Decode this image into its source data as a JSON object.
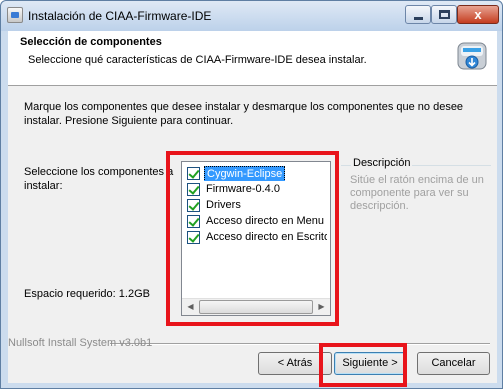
{
  "window": {
    "title": "Instalación de CIAA-Firmware-IDE",
    "close_glyph": "x"
  },
  "header": {
    "title": "Selección de componentes",
    "subtitle": "Seleccione qué características de CIAA-Firmware-IDE desea instalar."
  },
  "intro_text": "Marque los componentes que desee instalar y desmarque los componentes que no desee instalar. Presione Siguiente para continuar.",
  "select_label": "Seleccione los componentes a instalar:",
  "components": [
    {
      "label": "Cygwin-Eclipse",
      "checked": true,
      "selected": true
    },
    {
      "label": "Firmware-0.4.0",
      "checked": true,
      "selected": false
    },
    {
      "label": "Drivers",
      "checked": true,
      "selected": false
    },
    {
      "label": "Acceso directo en Menu Inicio",
      "checked": true,
      "selected": false
    },
    {
      "label": "Acceso directo en Escritorio",
      "checked": true,
      "selected": false
    }
  ],
  "space_required": "Espacio requerido: 1.2GB",
  "description": {
    "title": "Descripción",
    "text": "Sitúe el ratón encima de un componente para ver su descripción."
  },
  "footer": {
    "branding": "Nullsoft Install System v3.0b1"
  },
  "buttons": {
    "back": "< Atrás",
    "next": "Siguiente >",
    "cancel": "Cancelar"
  },
  "colors": {
    "highlight_box": "#e8141b",
    "selection": "#3399ff",
    "checkmark": "#21a121"
  }
}
